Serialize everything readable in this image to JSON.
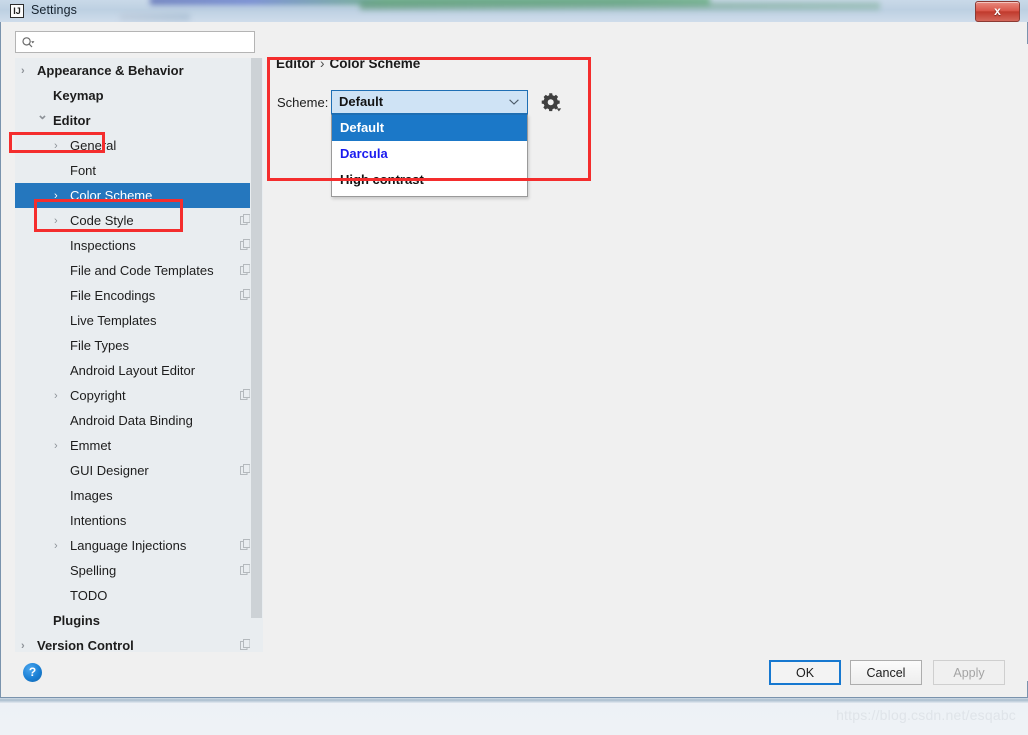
{
  "window": {
    "title": "Settings",
    "app_icon": "intellij-idea-icon",
    "close_label": "x"
  },
  "search": {
    "value": "",
    "placeholder": "",
    "icon": "search-icon"
  },
  "sidebar": {
    "items": [
      {
        "label": "Appearance & Behavior",
        "indent": 22,
        "arrow": true,
        "bold": true,
        "selected": false,
        "copy": false
      },
      {
        "label": "Keymap",
        "indent": 38,
        "arrow": false,
        "bold": true,
        "selected": false,
        "copy": false
      },
      {
        "label": "Editor",
        "indent": 38,
        "arrow": true,
        "arrow_open": true,
        "bold": true,
        "selected": false,
        "copy": false
      },
      {
        "label": "General",
        "indent": 55,
        "arrow": true,
        "bold": false,
        "selected": false,
        "copy": false
      },
      {
        "label": "Font",
        "indent": 55,
        "arrow": false,
        "bold": false,
        "selected": false,
        "copy": false
      },
      {
        "label": "Color Scheme",
        "indent": 55,
        "arrow": true,
        "bold": false,
        "selected": true,
        "copy": false
      },
      {
        "label": "Code Style",
        "indent": 55,
        "arrow": true,
        "bold": false,
        "selected": false,
        "copy": true
      },
      {
        "label": "Inspections",
        "indent": 55,
        "arrow": false,
        "bold": false,
        "selected": false,
        "copy": true
      },
      {
        "label": "File and Code Templates",
        "indent": 55,
        "arrow": false,
        "bold": false,
        "selected": false,
        "copy": true
      },
      {
        "label": "File Encodings",
        "indent": 55,
        "arrow": false,
        "bold": false,
        "selected": false,
        "copy": true
      },
      {
        "label": "Live Templates",
        "indent": 55,
        "arrow": false,
        "bold": false,
        "selected": false,
        "copy": false
      },
      {
        "label": "File Types",
        "indent": 55,
        "arrow": false,
        "bold": false,
        "selected": false,
        "copy": false
      },
      {
        "label": "Android Layout Editor",
        "indent": 55,
        "arrow": false,
        "bold": false,
        "selected": false,
        "copy": false
      },
      {
        "label": "Copyright",
        "indent": 55,
        "arrow": true,
        "bold": false,
        "selected": false,
        "copy": true
      },
      {
        "label": "Android Data Binding",
        "indent": 55,
        "arrow": false,
        "bold": false,
        "selected": false,
        "copy": false
      },
      {
        "label": "Emmet",
        "indent": 55,
        "arrow": true,
        "bold": false,
        "selected": false,
        "copy": false
      },
      {
        "label": "GUI Designer",
        "indent": 55,
        "arrow": false,
        "bold": false,
        "selected": false,
        "copy": true
      },
      {
        "label": "Images",
        "indent": 55,
        "arrow": false,
        "bold": false,
        "selected": false,
        "copy": false
      },
      {
        "label": "Intentions",
        "indent": 55,
        "arrow": false,
        "bold": false,
        "selected": false,
        "copy": false
      },
      {
        "label": "Language Injections",
        "indent": 55,
        "arrow": true,
        "bold": false,
        "selected": false,
        "copy": true
      },
      {
        "label": "Spelling",
        "indent": 55,
        "arrow": false,
        "bold": false,
        "selected": false,
        "copy": true
      },
      {
        "label": "TODO",
        "indent": 55,
        "arrow": false,
        "bold": false,
        "selected": false,
        "copy": false
      },
      {
        "label": "Plugins",
        "indent": 38,
        "arrow": false,
        "bold": true,
        "selected": false,
        "copy": false
      },
      {
        "label": "Version Control",
        "indent": 22,
        "arrow": true,
        "bold": true,
        "selected": false,
        "copy": true
      }
    ]
  },
  "main": {
    "breadcrumb": {
      "parent": "Editor",
      "separator": "›",
      "current": "Color Scheme"
    },
    "scheme": {
      "label": "Scheme:",
      "selected": "Default",
      "options": [
        {
          "label": "Default",
          "state": "highlight"
        },
        {
          "label": "Darcula",
          "state": "accent"
        },
        {
          "label": "High contrast",
          "state": "normal"
        }
      ]
    },
    "gear_icon": "gear-settings-icon"
  },
  "buttons": {
    "help": "?",
    "ok": "OK",
    "cancel": "Cancel",
    "apply": "Apply"
  },
  "watermark": "https://blog.csdn.net/esqabc",
  "colors": {
    "selection_blue": "#2577be",
    "dropdown_highlight": "#1b78c8",
    "darcula_text": "#1a1aef",
    "annotation_red": "#f42d2d",
    "combo_fill": "#cfe3f5",
    "combo_border": "#1f6fb4"
  }
}
